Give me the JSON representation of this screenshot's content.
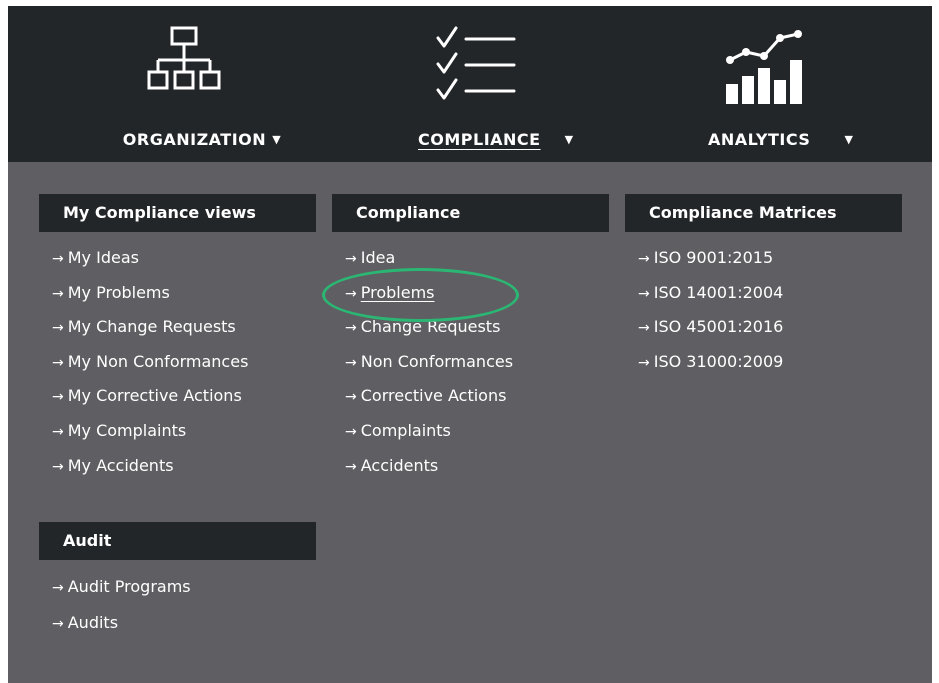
{
  "nav": [
    {
      "label": "ORGANIZATION",
      "icon": "org-chart-icon",
      "active": false
    },
    {
      "label": "COMPLIANCE",
      "icon": "checklist-icon",
      "active": true
    },
    {
      "label": "ANALYTICS",
      "icon": "analytics-chart-icon",
      "active": false
    }
  ],
  "arrow_glyph": "→",
  "caret_glyph": "▼",
  "sections": {
    "my_compliance_views": {
      "title": "My Compliance views",
      "items": [
        "My Ideas",
        "My Problems",
        "My Change Requests",
        "My Non Conformances",
        "My Corrective Actions",
        "My Complaints",
        "My Accidents"
      ]
    },
    "compliance": {
      "title": "Compliance",
      "items": [
        "Idea",
        "Problems",
        "Change Requests",
        "Non Conformances",
        "Corrective Actions",
        "Complaints",
        "Accidents"
      ],
      "highlighted_item": "Problems"
    },
    "compliance_matrices": {
      "title": "Compliance Matrices",
      "items": [
        "ISO 9001:2015",
        "ISO 14001:2004",
        "ISO 45001:2016",
        "ISO 31000:2009"
      ]
    },
    "audit": {
      "title": "Audit",
      "items": [
        "Audit Programs",
        "Audits"
      ]
    }
  },
  "colors": {
    "nav_background": "#232628",
    "panel_background": "#5f5e62",
    "text": "#ffffff",
    "highlight_ring": "#2bb673"
  }
}
